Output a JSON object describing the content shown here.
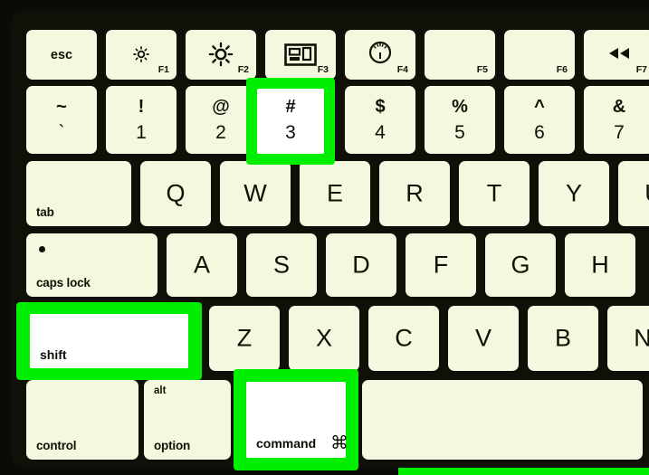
{
  "scene": {
    "title": "Mac keyboard shortcut illustration",
    "description": "Apple keyboard diagram with Shift, Command and 3 keys highlighted in green",
    "colors": {
      "highlight": "#00ee00",
      "key_face": "#f4f8de",
      "key_face_highlighted": "#ffffff",
      "body": "#100f08",
      "glyph": "#111105"
    }
  },
  "rows": {
    "function_row": [
      {
        "id": "esc",
        "label": "esc",
        "fn": "",
        "icon": "",
        "style": "esc"
      },
      {
        "id": "f1",
        "label": "",
        "fn": "F1",
        "icon": "brightness-down-icon",
        "style": "fn"
      },
      {
        "id": "f2",
        "label": "",
        "fn": "F2",
        "icon": "brightness-up-icon",
        "style": "fn"
      },
      {
        "id": "f3",
        "label": "",
        "fn": "F3",
        "icon": "mission-control-icon",
        "style": "fn"
      },
      {
        "id": "f4",
        "label": "",
        "fn": "F4",
        "icon": "dashboard-gauge-icon",
        "style": "fn"
      },
      {
        "id": "f5",
        "label": "",
        "fn": "F5",
        "icon": "",
        "style": "fn"
      },
      {
        "id": "f6",
        "label": "",
        "fn": "F6",
        "icon": "",
        "style": "fn"
      },
      {
        "id": "f7",
        "label": "",
        "fn": "F7",
        "icon": "rewind-icon",
        "style": "fn"
      }
    ],
    "number_row": [
      {
        "id": "tilde",
        "upper": "~",
        "lower": "`"
      },
      {
        "id": "one",
        "upper": "!",
        "lower": "1"
      },
      {
        "id": "two",
        "upper": "@",
        "lower": "2"
      },
      {
        "id": "three",
        "upper": "#",
        "lower": "3",
        "highlighted": true
      },
      {
        "id": "four",
        "upper": "$",
        "lower": "4"
      },
      {
        "id": "five",
        "upper": "%",
        "lower": "5"
      },
      {
        "id": "six",
        "upper": "^",
        "lower": "6"
      },
      {
        "id": "seven",
        "upper": "&",
        "lower": "7"
      }
    ],
    "qwerty_row": [
      {
        "id": "tab",
        "label": "tab",
        "style": "modifier"
      },
      {
        "id": "q",
        "label": "Q",
        "style": "letter"
      },
      {
        "id": "w",
        "label": "W",
        "style": "letter"
      },
      {
        "id": "e",
        "label": "E",
        "style": "letter"
      },
      {
        "id": "r",
        "label": "R",
        "style": "letter"
      },
      {
        "id": "t",
        "label": "T",
        "style": "letter"
      },
      {
        "id": "y",
        "label": "Y",
        "style": "letter"
      },
      {
        "id": "u",
        "label": "U",
        "style": "letter"
      }
    ],
    "home_row": [
      {
        "id": "capslock",
        "label": "caps lock",
        "style": "modifier",
        "led": true
      },
      {
        "id": "a",
        "label": "A",
        "style": "letter"
      },
      {
        "id": "s",
        "label": "S",
        "style": "letter"
      },
      {
        "id": "d",
        "label": "D",
        "style": "letter"
      },
      {
        "id": "f",
        "label": "F",
        "style": "letter"
      },
      {
        "id": "g",
        "label": "G",
        "style": "letter"
      },
      {
        "id": "h",
        "label": "H",
        "style": "letter"
      }
    ],
    "shift_row": [
      {
        "id": "shift",
        "label": "shift",
        "style": "modifier",
        "highlighted": true
      },
      {
        "id": "z",
        "label": "Z",
        "style": "letter"
      },
      {
        "id": "x",
        "label": "X",
        "style": "letter"
      },
      {
        "id": "c",
        "label": "C",
        "style": "letter"
      },
      {
        "id": "v",
        "label": "V",
        "style": "letter"
      },
      {
        "id": "b",
        "label": "B",
        "style": "letter"
      },
      {
        "id": "n",
        "label": "N",
        "style": "letter"
      }
    ],
    "bottom_row": [
      {
        "id": "control",
        "label": "control",
        "secondary": "",
        "style": "modifier"
      },
      {
        "id": "option",
        "label": "option",
        "secondary": "alt",
        "style": "modifier"
      },
      {
        "id": "command",
        "label": "command",
        "symbol": "⌘",
        "style": "command",
        "highlighted": true
      },
      {
        "id": "space",
        "label": "",
        "style": "space"
      }
    ]
  },
  "highlights": [
    {
      "id": "highlight-key-3",
      "target": "3"
    },
    {
      "id": "highlight-key-shift",
      "target": "shift"
    },
    {
      "id": "highlight-key-command",
      "target": "command"
    },
    {
      "id": "highlight-strip-bottom",
      "target": ""
    }
  ]
}
